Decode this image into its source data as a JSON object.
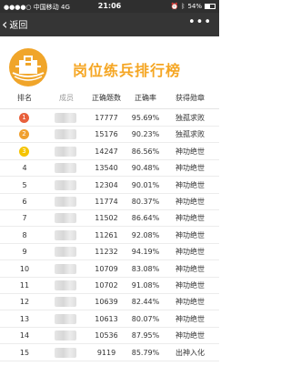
{
  "status_bar": {
    "carrier": "中国移动",
    "network": "4G",
    "time": "21:06",
    "battery": "54%",
    "battery_level": 0.54
  },
  "nav": {
    "back_label": "返回",
    "more_icon": "more-icon"
  },
  "banner": {
    "title": "岗位练兵排行榜",
    "emblem_icon": "tax-emblem-icon",
    "title_color": "#f5a623"
  },
  "table": {
    "headers": {
      "rank": "排名",
      "name": "成员",
      "count": "正确题数",
      "rate": "正确率",
      "badge": "获得勋章"
    },
    "rows": [
      {
        "rank": "1",
        "count": "17777",
        "rate": "95.69%",
        "badge": "独孤求败"
      },
      {
        "rank": "2",
        "count": "15176",
        "rate": "90.23%",
        "badge": "独孤求败"
      },
      {
        "rank": "3",
        "count": "14247",
        "rate": "86.56%",
        "badge": "神功绝世"
      },
      {
        "rank": "4",
        "count": "13540",
        "rate": "90.48%",
        "badge": "神功绝世"
      },
      {
        "rank": "5",
        "count": "12304",
        "rate": "90.01%",
        "badge": "神功绝世"
      },
      {
        "rank": "6",
        "count": "11774",
        "rate": "80.37%",
        "badge": "神功绝世"
      },
      {
        "rank": "7",
        "count": "11502",
        "rate": "86.64%",
        "badge": "神功绝世"
      },
      {
        "rank": "8",
        "count": "11261",
        "rate": "92.08%",
        "badge": "神功绝世"
      },
      {
        "rank": "9",
        "count": "11232",
        "rate": "94.19%",
        "badge": "神功绝世"
      },
      {
        "rank": "10",
        "count": "10709",
        "rate": "83.08%",
        "badge": "神功绝世"
      },
      {
        "rank": "11",
        "count": "10702",
        "rate": "91.08%",
        "badge": "神功绝世"
      },
      {
        "rank": "12",
        "count": "10639",
        "rate": "82.44%",
        "badge": "神功绝世"
      },
      {
        "rank": "13",
        "count": "10613",
        "rate": "80.07%",
        "badge": "神功绝世"
      },
      {
        "rank": "14",
        "count": "10536",
        "rate": "87.95%",
        "badge": "神功绝世"
      },
      {
        "rank": "15",
        "count": "9119",
        "rate": "85.79%",
        "badge": "出神入化"
      }
    ],
    "medal_colors": [
      "#e8603c",
      "#f0a030",
      "#f5c400"
    ]
  }
}
